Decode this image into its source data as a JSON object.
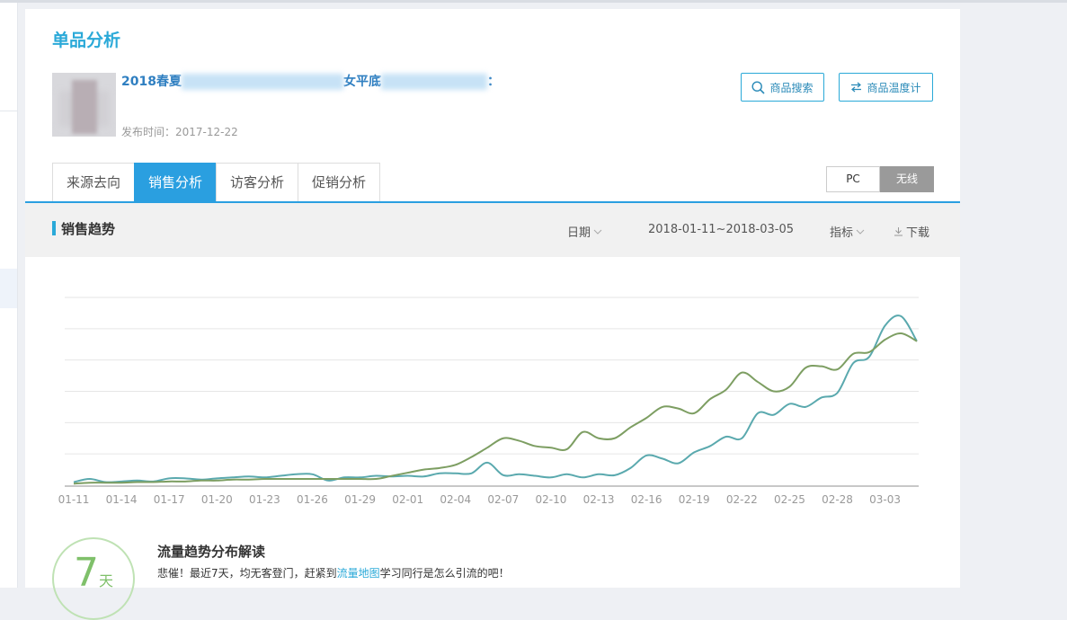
{
  "page": {
    "title": "单品分析"
  },
  "product": {
    "name_start": "2018春夏",
    "name_mid": "女平底",
    "name_end": "：",
    "publish_label": "发布时间：",
    "publish_date": "2017-12-22"
  },
  "buttons": {
    "search": "商品搜索",
    "temperature": "商品温度计"
  },
  "tabs": [
    "来源去向",
    "销售分析",
    "访客分析",
    "促销分析"
  ],
  "active_tab": 1,
  "device": {
    "pc": "PC",
    "wireless": "无线",
    "selected": "无线"
  },
  "section": {
    "title": "销售趋势",
    "date_label": "日期",
    "date_range": "2018-01-11~2018-03-05",
    "metric_label": "指标",
    "download_label": "下载"
  },
  "chart_data": {
    "type": "line",
    "title": "",
    "xlabel": "",
    "ylabel": "",
    "y_tick_labels_shown": false,
    "grid": "horizontal",
    "tick_labels": [
      "01-11",
      "01-14",
      "01-17",
      "01-20",
      "01-23",
      "01-26",
      "01-29",
      "02-01",
      "02-04",
      "02-07",
      "02-10",
      "02-13",
      "02-16",
      "02-19",
      "02-22",
      "02-25",
      "02-28",
      "03-03"
    ],
    "x": [
      "01-11",
      "01-12",
      "01-13",
      "01-14",
      "01-15",
      "01-16",
      "01-17",
      "01-18",
      "01-19",
      "01-20",
      "01-21",
      "01-22",
      "01-23",
      "01-24",
      "01-25",
      "01-26",
      "01-27",
      "01-28",
      "01-29",
      "01-30",
      "01-31",
      "02-01",
      "02-02",
      "02-03",
      "02-04",
      "02-05",
      "02-06",
      "02-07",
      "02-08",
      "02-09",
      "02-10",
      "02-11",
      "02-12",
      "02-13",
      "02-14",
      "02-15",
      "02-16",
      "02-17",
      "02-18",
      "02-19",
      "02-20",
      "02-21",
      "02-22",
      "02-23",
      "02-24",
      "02-25",
      "02-26",
      "02-27",
      "02-28",
      "03-01",
      "03-02",
      "03-03",
      "03-04",
      "03-05"
    ],
    "ylim": [
      0,
      6
    ],
    "series": [
      {
        "color": "#5aa9ae",
        "values": [
          0.1,
          0.2,
          0.1,
          0.12,
          0.15,
          0.12,
          0.22,
          0.22,
          0.18,
          0.22,
          0.25,
          0.28,
          0.25,
          0.3,
          0.35,
          0.35,
          0.15,
          0.25,
          0.25,
          0.3,
          0.28,
          0.3,
          0.28,
          0.38,
          0.38,
          0.38,
          0.72,
          0.32,
          0.35,
          0.3,
          0.25,
          0.35,
          0.25,
          0.35,
          0.32,
          0.55,
          0.95,
          0.85,
          0.7,
          1.05,
          1.25,
          1.55,
          1.5,
          2.3,
          2.25,
          2.6,
          2.5,
          2.8,
          2.95,
          3.9,
          4.1,
          5.1,
          5.4,
          4.6
        ]
      },
      {
        "color": "#7d9e62",
        "values": [
          0.05,
          0.08,
          0.08,
          0.08,
          0.1,
          0.1,
          0.12,
          0.12,
          0.15,
          0.15,
          0.18,
          0.18,
          0.2,
          0.2,
          0.2,
          0.2,
          0.2,
          0.2,
          0.2,
          0.2,
          0.3,
          0.4,
          0.5,
          0.55,
          0.65,
          0.9,
          1.2,
          1.5,
          1.42,
          1.25,
          1.2,
          1.15,
          1.7,
          1.5,
          1.5,
          1.85,
          2.15,
          2.5,
          2.45,
          2.3,
          2.75,
          3.05,
          3.6,
          3.3,
          3.0,
          3.15,
          3.75,
          3.8,
          3.7,
          4.2,
          4.25,
          4.65,
          4.85,
          4.6
        ]
      }
    ]
  },
  "insight": {
    "days": "7",
    "days_unit": "天",
    "title": "流量趋势分布解读",
    "text_before": "悲催！最近7天，均无客登门，赶紧到",
    "link": "流量地图",
    "text_after": "学习同行是怎么引流的吧！"
  }
}
